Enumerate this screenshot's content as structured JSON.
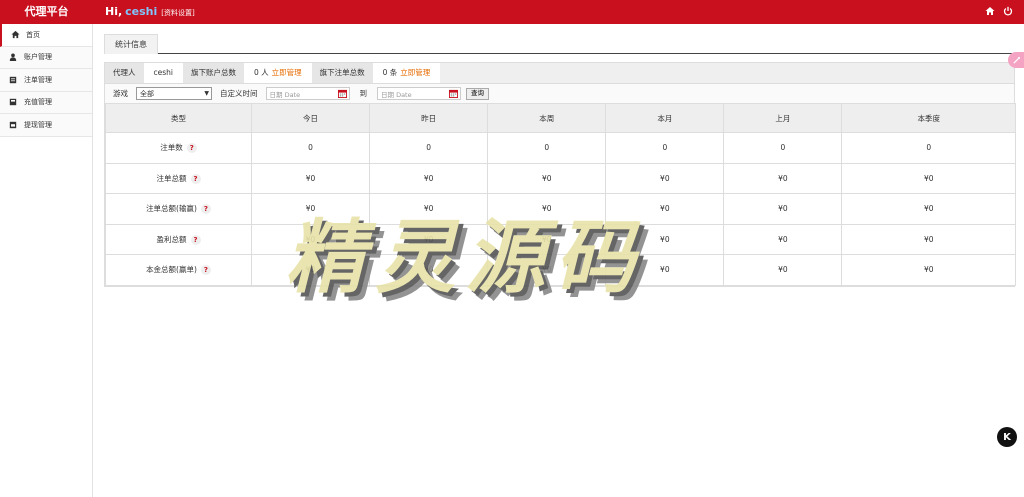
{
  "header": {
    "brand": "代理平台",
    "greeting": "Hi,",
    "username": "ceshi",
    "settings_link": "[资料设置]",
    "icons": [
      "home-icon",
      "power-icon"
    ]
  },
  "sidebar": {
    "items": [
      {
        "label": "首页",
        "icon": "home-icon",
        "active": true
      },
      {
        "label": "账户管理",
        "icon": "user-icon",
        "active": false
      },
      {
        "label": "注单管理",
        "icon": "ticket-icon",
        "active": false
      },
      {
        "label": "充值管理",
        "icon": "card-icon",
        "active": false
      },
      {
        "label": "提现管理",
        "icon": "wallet-icon",
        "active": false
      }
    ]
  },
  "tabs": [
    {
      "label": "统计信息"
    }
  ],
  "summary": {
    "agent_label": "代理人",
    "agent_value": "ceshi",
    "accounts_label": "旗下账户总数",
    "accounts_value": "0 人",
    "accounts_link": "立即管理",
    "bets_label": "旗下注单总数",
    "bets_value": "0 条",
    "bets_link": "立即管理"
  },
  "filters": {
    "game_label": "游戏",
    "game_selected": "全部",
    "custom_time_label": "自定义时间",
    "date_placeholder_from": "日期 Date",
    "to_label": "到",
    "date_placeholder_to": "日期 Date",
    "query_button": "查询"
  },
  "table": {
    "headers": [
      "类型",
      "今日",
      "昨日",
      "本周",
      "本月",
      "上月",
      "本季度"
    ],
    "rows": [
      {
        "label": "注单数",
        "values": [
          "0",
          "0",
          "0",
          "0",
          "0",
          "0"
        ]
      },
      {
        "label": "注单总额",
        "values": [
          "¥0",
          "¥0",
          "¥0",
          "¥0",
          "¥0",
          "¥0"
        ]
      },
      {
        "label": "注单总额(输赢)",
        "values": [
          "¥0",
          "¥0",
          "¥0",
          "¥0",
          "¥0",
          "¥0"
        ]
      },
      {
        "label": "盈利总额",
        "values": [
          "¥0",
          "¥0",
          "¥0",
          "¥0",
          "¥0",
          "¥0"
        ]
      },
      {
        "label": "本金总额(赢单)",
        "values": [
          "¥0",
          "¥0",
          "¥0",
          "¥0",
          "¥0",
          "¥0"
        ]
      }
    ],
    "help_mark": "?"
  },
  "watermark": "精灵源码",
  "floating": {
    "k_label": "K"
  },
  "colors": {
    "brand_red": "#c8101e",
    "link_orange": "#e66b00",
    "username_blue": "#7fc6ff"
  }
}
